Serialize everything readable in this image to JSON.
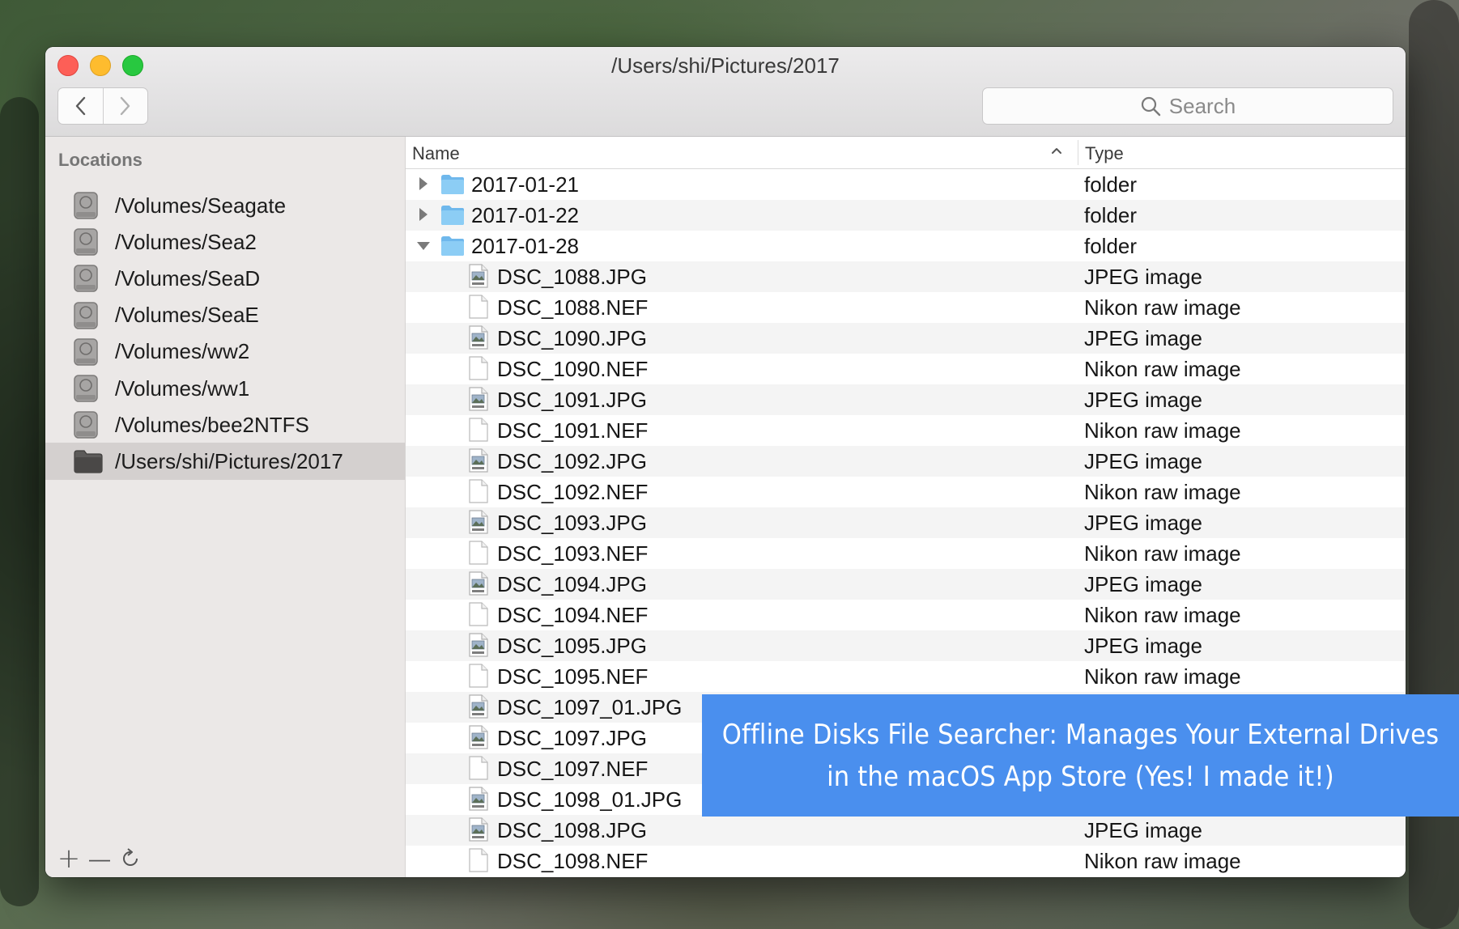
{
  "window": {
    "title": "/Users/shi/Pictures/2017"
  },
  "toolbar": {
    "back_icon": "chevron-left-icon",
    "forward_icon": "chevron-right-icon",
    "search_placeholder": "Search"
  },
  "sidebar": {
    "header": "Locations",
    "items": [
      {
        "label": "/Volumes/Seagate",
        "icon": "drive-icon"
      },
      {
        "label": "/Volumes/Sea2",
        "icon": "drive-icon"
      },
      {
        "label": "/Volumes/SeaD",
        "icon": "drive-icon"
      },
      {
        "label": "/Volumes/SeaE",
        "icon": "drive-icon"
      },
      {
        "label": "/Volumes/ww2",
        "icon": "drive-icon"
      },
      {
        "label": "/Volumes/ww1",
        "icon": "drive-icon"
      },
      {
        "label": "/Volumes/bee2NTFS",
        "icon": "drive-icon"
      },
      {
        "label": "/Users/shi/Pictures/2017",
        "icon": "folder-icon",
        "selected": true
      }
    ],
    "tools": {
      "add": "+",
      "remove": "—",
      "refresh_icon": "refresh-icon"
    }
  },
  "table": {
    "columns": {
      "name": "Name",
      "type": "Type"
    },
    "rows": [
      {
        "name": "2017-01-21",
        "type": "folder",
        "kind": "folder",
        "expanded": false
      },
      {
        "name": "2017-01-22",
        "type": "folder",
        "kind": "folder",
        "expanded": false
      },
      {
        "name": "2017-01-28",
        "type": "folder",
        "kind": "folder",
        "expanded": true
      },
      {
        "name": "DSC_1088.JPG",
        "type": "JPEG image",
        "kind": "jpeg"
      },
      {
        "name": "DSC_1088.NEF",
        "type": "Nikon raw image",
        "kind": "file"
      },
      {
        "name": "DSC_1090.JPG",
        "type": "JPEG image",
        "kind": "jpeg"
      },
      {
        "name": "DSC_1090.NEF",
        "type": "Nikon raw image",
        "kind": "file"
      },
      {
        "name": "DSC_1091.JPG",
        "type": "JPEG image",
        "kind": "jpeg"
      },
      {
        "name": "DSC_1091.NEF",
        "type": "Nikon raw image",
        "kind": "file"
      },
      {
        "name": "DSC_1092.JPG",
        "type": "JPEG image",
        "kind": "jpeg"
      },
      {
        "name": "DSC_1092.NEF",
        "type": "Nikon raw image",
        "kind": "file"
      },
      {
        "name": "DSC_1093.JPG",
        "type": "JPEG image",
        "kind": "jpeg"
      },
      {
        "name": "DSC_1093.NEF",
        "type": "Nikon raw image",
        "kind": "file"
      },
      {
        "name": "DSC_1094.JPG",
        "type": "JPEG image",
        "kind": "jpeg"
      },
      {
        "name": "DSC_1094.NEF",
        "type": "Nikon raw image",
        "kind": "file"
      },
      {
        "name": "DSC_1095.JPG",
        "type": "JPEG image",
        "kind": "jpeg"
      },
      {
        "name": "DSC_1095.NEF",
        "type": "Nikon raw image",
        "kind": "file"
      },
      {
        "name": "DSC_1097_01.JPG",
        "type": "",
        "kind": "jpeg"
      },
      {
        "name": "DSC_1097.JPG",
        "type": "",
        "kind": "jpeg"
      },
      {
        "name": "DSC_1097.NEF",
        "type": "",
        "kind": "file"
      },
      {
        "name": "DSC_1098_01.JPG",
        "type": "",
        "kind": "jpeg"
      },
      {
        "name": "DSC_1098.JPG",
        "type": "JPEG image",
        "kind": "jpeg"
      },
      {
        "name": "DSC_1098.NEF",
        "type": "Nikon raw image",
        "kind": "file"
      }
    ]
  },
  "banner": {
    "line1": "Offline Disks File Searcher: Manages Your External Drives",
    "line2": "in the macOS App Store (Yes! I made it!)",
    "color": "#4a8fee"
  }
}
